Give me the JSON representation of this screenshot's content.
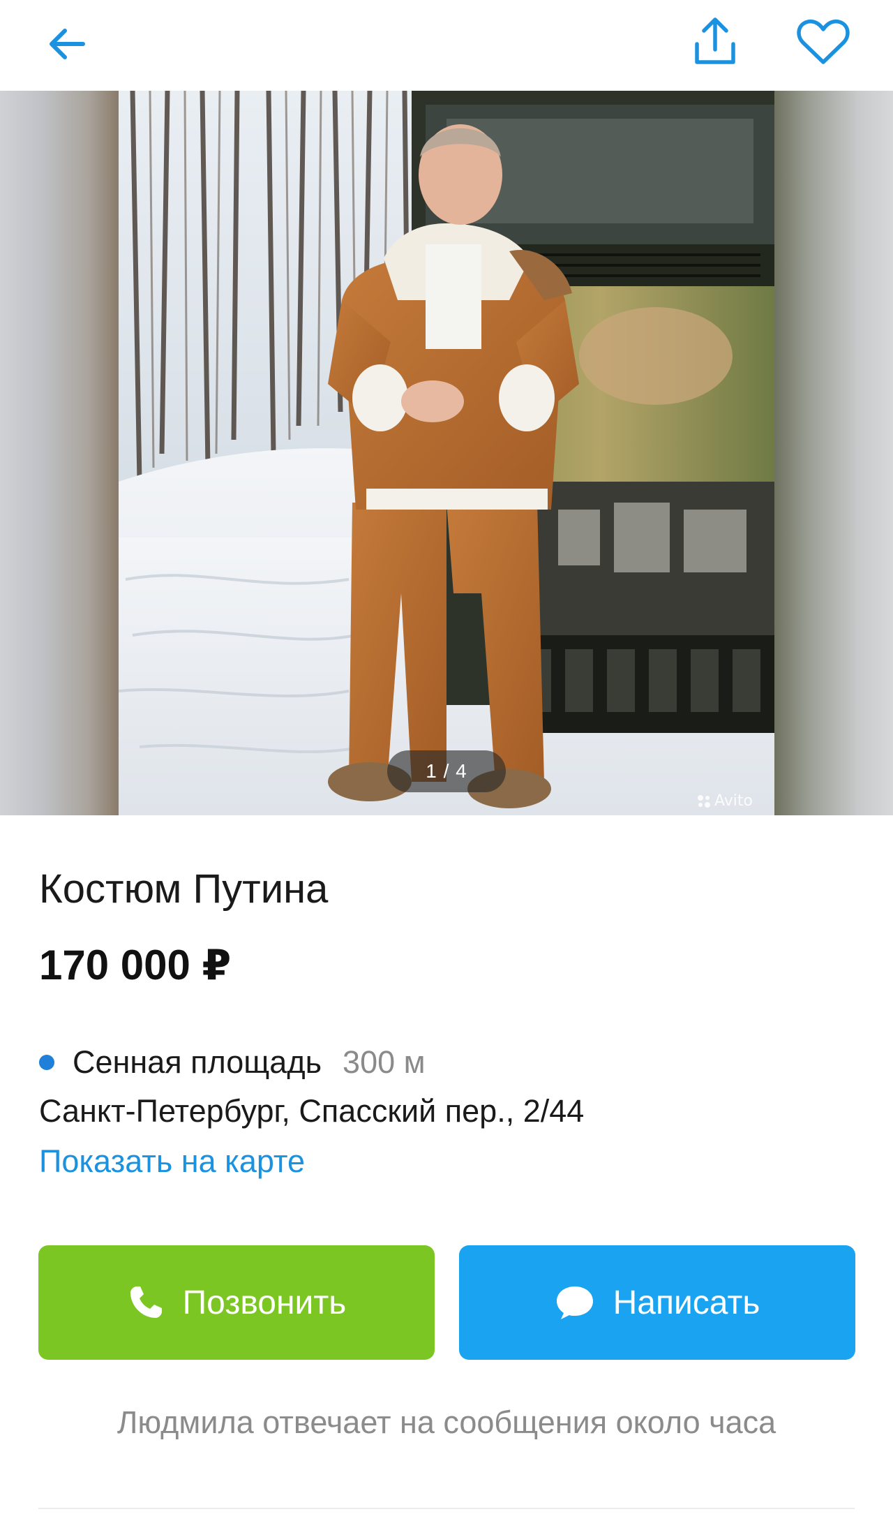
{
  "header": {
    "back_icon": "arrow-left-icon",
    "share_icon": "share-icon",
    "favorite_icon": "heart-icon",
    "accent_color": "#1b92e0"
  },
  "gallery": {
    "counter": "1 / 4",
    "watermark": "Avito"
  },
  "listing": {
    "title": "Костюм Путина",
    "price": "170 000 ₽",
    "metro": {
      "name": "Сенная площадь",
      "distance": "300 м",
      "line_color": "#1f7fd9"
    },
    "address": "Санкт-Петербург, Спасский пер., 2/44",
    "map_link": "Показать на карте"
  },
  "actions": {
    "call": {
      "label": "Позвонить",
      "icon": "phone-icon",
      "color": "#7cc623"
    },
    "message": {
      "label": "Написать",
      "icon": "chat-bubble-icon",
      "color": "#1aa3f0"
    }
  },
  "seller_note": "Людмила отвечает на сообщения около часа"
}
